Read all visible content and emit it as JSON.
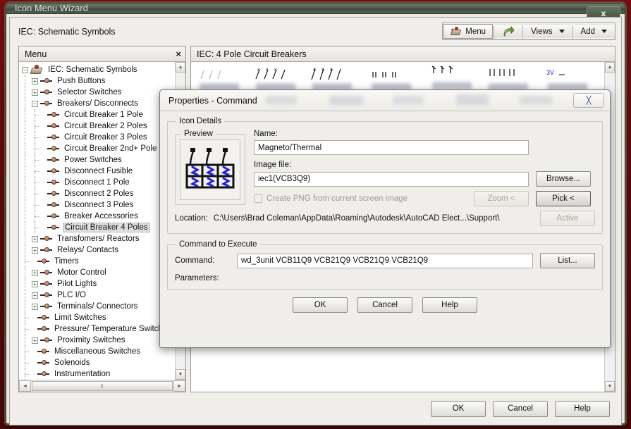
{
  "window": {
    "title": "Icon Menu Wizard",
    "close_label": "x",
    "header_label": "IEC: Schematic Symbols",
    "toolbar": {
      "menu_label": "Menu",
      "menu_icon": "menu-book-icon",
      "refresh_icon": "green-arrow-icon",
      "views_label": "Views",
      "add_label": "Add"
    },
    "buttons": {
      "ok": "OK",
      "cancel": "Cancel",
      "help": "Help"
    }
  },
  "menu_panel": {
    "header": "Menu",
    "close_label": "×",
    "scroll": {
      "up": "▲",
      "down": "▼",
      "left": "◄",
      "right": "►",
      "grip": "‖"
    },
    "tree": [
      {
        "label": "IEC: Schematic Symbols",
        "depth": 0,
        "expander": "minus",
        "icon": "menu-book-icon",
        "selected": false
      },
      {
        "label": "Push Buttons",
        "depth": 1,
        "expander": "plus",
        "icon": "symbol-icon",
        "selected": false
      },
      {
        "label": "Selector Switches",
        "depth": 1,
        "expander": "plus",
        "icon": "symbol-icon",
        "selected": false
      },
      {
        "label": "Breakers/ Disconnects",
        "depth": 1,
        "expander": "minus",
        "icon": "symbol-icon",
        "selected": false
      },
      {
        "label": "Circuit Breaker 1 Pole",
        "depth": 2,
        "expander": "none",
        "icon": "symbol-icon",
        "selected": false
      },
      {
        "label": "Circuit Breaker 2 Poles",
        "depth": 2,
        "expander": "none",
        "icon": "symbol-icon",
        "selected": false
      },
      {
        "label": "Circuit Breaker 3 Poles",
        "depth": 2,
        "expander": "none",
        "icon": "symbol-icon",
        "selected": false
      },
      {
        "label": "Circuit Breaker 2nd+ Pole",
        "depth": 2,
        "expander": "none",
        "icon": "symbol-icon",
        "selected": false
      },
      {
        "label": "Power Switches",
        "depth": 2,
        "expander": "none",
        "icon": "symbol-icon",
        "selected": false
      },
      {
        "label": "Disconnect Fusible",
        "depth": 2,
        "expander": "none",
        "icon": "symbol-icon",
        "selected": false
      },
      {
        "label": "Disconnect 1 Pole",
        "depth": 2,
        "expander": "none",
        "icon": "symbol-icon",
        "selected": false
      },
      {
        "label": "Disconnect 2 Poles",
        "depth": 2,
        "expander": "none",
        "icon": "symbol-icon",
        "selected": false
      },
      {
        "label": "Disconnect 3 Poles",
        "depth": 2,
        "expander": "none",
        "icon": "symbol-icon",
        "selected": false
      },
      {
        "label": "Breaker Accessories",
        "depth": 2,
        "expander": "none",
        "icon": "symbol-icon",
        "selected": false
      },
      {
        "label": "Circuit Breaker 4 Poles",
        "depth": 2,
        "expander": "none",
        "icon": "symbol-icon",
        "selected": true
      },
      {
        "label": "Transfomers/ Reactors",
        "depth": 1,
        "expander": "plus",
        "icon": "symbol-icon",
        "selected": false
      },
      {
        "label": "Relays/ Contacts",
        "depth": 1,
        "expander": "plus",
        "icon": "symbol-icon",
        "selected": false
      },
      {
        "label": "Timers",
        "depth": 1,
        "expander": "none",
        "icon": "symbol-icon",
        "selected": false
      },
      {
        "label": "Motor Control",
        "depth": 1,
        "expander": "plus",
        "icon": "symbol-icon",
        "selected": false
      },
      {
        "label": "Pilot Lights",
        "depth": 1,
        "expander": "plus",
        "icon": "symbol-icon",
        "selected": false
      },
      {
        "label": "PLC I/O",
        "depth": 1,
        "expander": "plus",
        "icon": "symbol-icon",
        "selected": false
      },
      {
        "label": "Terminals/ Connectors",
        "depth": 1,
        "expander": "plus",
        "icon": "symbol-icon",
        "selected": false
      },
      {
        "label": "Limit Switches",
        "depth": 1,
        "expander": "none",
        "icon": "symbol-icon",
        "selected": false
      },
      {
        "label": "Pressure/ Temperature Switches",
        "depth": 1,
        "expander": "none",
        "icon": "symbol-icon",
        "selected": false
      },
      {
        "label": "Proximity Switches",
        "depth": 1,
        "expander": "plus",
        "icon": "symbol-icon",
        "selected": false
      },
      {
        "label": "Miscellaneous Switches",
        "depth": 1,
        "expander": "none",
        "icon": "symbol-icon",
        "selected": false
      },
      {
        "label": "Solenoids",
        "depth": 1,
        "expander": "none",
        "icon": "symbol-icon",
        "selected": false
      },
      {
        "label": "Instrumentation",
        "depth": 1,
        "expander": "none",
        "icon": "symbol-icon",
        "selected": false
      }
    ]
  },
  "icon_panel": {
    "header": "IEC: 4 Pole Circuit Breakers"
  },
  "dialog": {
    "title": "Properties - Command",
    "close_label": "╳",
    "icon_details": {
      "legend": "Icon Details",
      "preview_legend": "Preview",
      "preview_icon": "circuit-breaker-3-pole-icon",
      "name_label": "Name:",
      "name_value": "Magneto/Thermal",
      "image_file_label": "Image file:",
      "image_file_value": "iec1(VCB3Q9)",
      "browse_label": "Browse...",
      "create_png_label": "Create PNG from current screen image",
      "create_png_checked": false,
      "zoom_label": "Zoom <",
      "zoom_disabled": true,
      "pick_label": "Pick <",
      "active_label": "Active",
      "active_disabled": true,
      "location_label": "Location:",
      "location_value": "C:\\Users\\Brad Coleman\\AppData\\Roaming\\Autodesk\\AutoCAD Elect...\\Support\\"
    },
    "command_group": {
      "legend": "Command to Execute",
      "command_label": "Command:",
      "command_value": "wd_3unit VCB11Q9 VCB21Q9 VCB21Q9 VCB21Q9",
      "list_label": "List...",
      "parameters_label": "Parameters:",
      "parameters_value": ""
    },
    "buttons": {
      "ok": "OK",
      "cancel": "Cancel",
      "help": "Help"
    }
  },
  "colors": {
    "desktop": "#6d0b0b",
    "title_bar": "#4f5c4e",
    "window_bg": "#f0eeea",
    "selection": "#dfdfdf",
    "symbol_blue": "#2222dd"
  }
}
